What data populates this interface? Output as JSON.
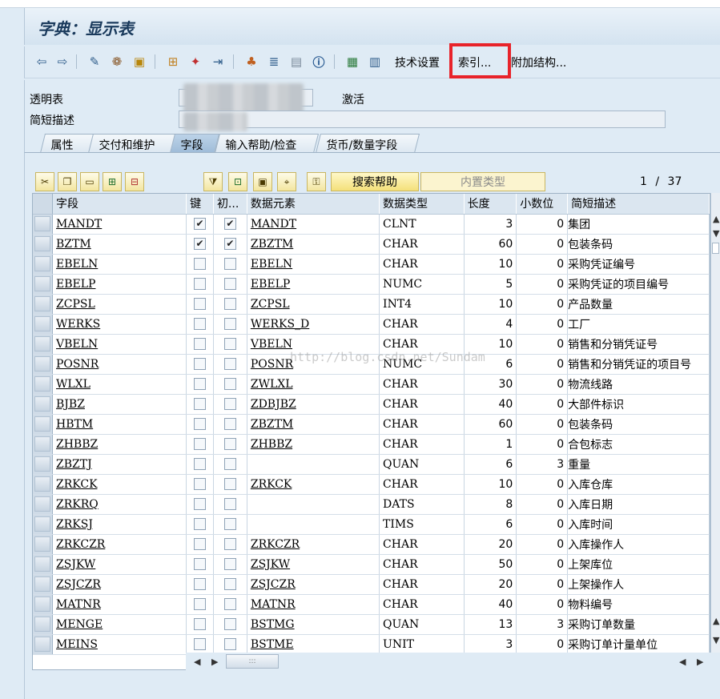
{
  "window": {
    "title": "字典：显示表"
  },
  "toolbar": {
    "icons": [
      "back-icon",
      "forward-icon",
      "display-change-icon",
      "other-object-icon",
      "activate-icon",
      "where-used-icon",
      "check-icon",
      "transport-icon",
      "hierarchy-icon",
      "object-list-icon",
      "display-object-icon",
      "info-icon",
      "structure-icon",
      "contents-icon"
    ],
    "tech_settings": "技术设置",
    "index": "索引...",
    "append_structure": "附加结构..."
  },
  "form": {
    "transparent_table_label": "透明表",
    "status": "激活",
    "short_desc_label": "简短描述"
  },
  "tabs": [
    {
      "label": "属性"
    },
    {
      "label": "交付和维护"
    },
    {
      "label": "字段"
    },
    {
      "label": "输入帮助/检查"
    },
    {
      "label": "货币/数量字段"
    }
  ],
  "grid_toolbar": {
    "search_help": "搜索帮助",
    "builtin_type": "内置类型",
    "pager_current": "1",
    "pager_sep": "/",
    "pager_total": "37"
  },
  "table": {
    "headers": [
      "字段",
      "键",
      "初...",
      "数据元素",
      "数据类型",
      "长度",
      "小数位",
      "简短描述"
    ],
    "rows": [
      {
        "field": "MANDT",
        "key": true,
        "init": true,
        "element": "MANDT",
        "type": "CLNT",
        "length": "3",
        "decimals": "0",
        "desc": "集团"
      },
      {
        "field": "BZTM",
        "key": true,
        "init": true,
        "element": "ZBZTM",
        "type": "CHAR",
        "length": "60",
        "decimals": "0",
        "desc": "包装条码"
      },
      {
        "field": "EBELN",
        "key": false,
        "init": false,
        "element": "EBELN",
        "type": "CHAR",
        "length": "10",
        "decimals": "0",
        "desc": "采购凭证编号"
      },
      {
        "field": "EBELP",
        "key": false,
        "init": false,
        "element": "EBELP",
        "type": "NUMC",
        "length": "5",
        "decimals": "0",
        "desc": "采购凭证的项目编号"
      },
      {
        "field": "ZCPSL",
        "key": false,
        "init": false,
        "element": "ZCPSL",
        "type": "INT4",
        "length": "10",
        "decimals": "0",
        "desc": "产品数量"
      },
      {
        "field": "WERKS",
        "key": false,
        "init": false,
        "element": "WERKS_D",
        "type": "CHAR",
        "length": "4",
        "decimals": "0",
        "desc": "工厂"
      },
      {
        "field": "VBELN",
        "key": false,
        "init": false,
        "element": "VBELN",
        "type": "CHAR",
        "length": "10",
        "decimals": "0",
        "desc": "销售和分销凭证号"
      },
      {
        "field": "POSNR",
        "key": false,
        "init": false,
        "element": "POSNR",
        "type": "NUMC",
        "length": "6",
        "decimals": "0",
        "desc": "销售和分销凭证的项目号"
      },
      {
        "field": "WLXL",
        "key": false,
        "init": false,
        "element": "ZWLXL",
        "type": "CHAR",
        "length": "30",
        "decimals": "0",
        "desc": "物流线路"
      },
      {
        "field": "BJBZ",
        "key": false,
        "init": false,
        "element": "ZDBJBZ",
        "type": "CHAR",
        "length": "40",
        "decimals": "0",
        "desc": "大部件标识"
      },
      {
        "field": "HBTM",
        "key": false,
        "init": false,
        "element": "ZBZTM",
        "type": "CHAR",
        "length": "60",
        "decimals": "0",
        "desc": "包装条码"
      },
      {
        "field": "ZHBBZ",
        "key": false,
        "init": false,
        "element": "ZHBBZ",
        "type": "CHAR",
        "length": "1",
        "decimals": "0",
        "desc": "合包标志"
      },
      {
        "field": "ZBZTJ",
        "key": false,
        "init": false,
        "element": "",
        "type": "QUAN",
        "length": "6",
        "decimals": "3",
        "desc": "重量"
      },
      {
        "field": "ZRKCK",
        "key": false,
        "init": false,
        "element": "ZRKCK",
        "type": "CHAR",
        "length": "10",
        "decimals": "0",
        "desc": "入库仓库"
      },
      {
        "field": "ZRKRQ",
        "key": false,
        "init": false,
        "element": "",
        "type": "DATS",
        "length": "8",
        "decimals": "0",
        "desc": "入库日期"
      },
      {
        "field": "ZRKSJ",
        "key": false,
        "init": false,
        "element": "",
        "type": "TIMS",
        "length": "6",
        "decimals": "0",
        "desc": "入库时间"
      },
      {
        "field": "ZRKCZR",
        "key": false,
        "init": false,
        "element": "ZRKCZR",
        "type": "CHAR",
        "length": "20",
        "decimals": "0",
        "desc": "入库操作人"
      },
      {
        "field": "ZSJKW",
        "key": false,
        "init": false,
        "element": "ZSJKW",
        "type": "CHAR",
        "length": "50",
        "decimals": "0",
        "desc": "上架库位"
      },
      {
        "field": "ZSJCZR",
        "key": false,
        "init": false,
        "element": "ZSJCZR",
        "type": "CHAR",
        "length": "20",
        "decimals": "0",
        "desc": "上架操作人"
      },
      {
        "field": "MATNR",
        "key": false,
        "init": false,
        "element": "MATNR",
        "type": "CHAR",
        "length": "40",
        "decimals": "0",
        "desc": "物料编号"
      },
      {
        "field": "MENGE",
        "key": false,
        "init": false,
        "element": "BSTMG",
        "type": "QUAN",
        "length": "13",
        "decimals": "3",
        "desc": "采购订单数量"
      },
      {
        "field": "MEINS",
        "key": false,
        "init": false,
        "element": "BSTME",
        "type": "UNIT",
        "length": "3",
        "decimals": "0",
        "desc": "采购订单计量单位"
      }
    ]
  },
  "watermark": "http://blog.csdn.net/Sundam",
  "colors": {
    "highlight_box": "#e8232a",
    "sap_blue_bg": "#dfebf5"
  }
}
